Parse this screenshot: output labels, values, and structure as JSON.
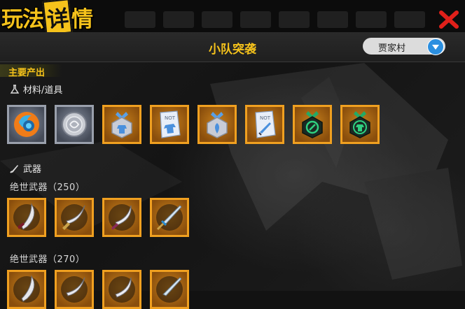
{
  "header": {
    "title_chars": [
      "玩",
      "法",
      "详",
      "情"
    ],
    "panel_title": "小队突袭",
    "dropdown": {
      "selected": "贾家村"
    }
  },
  "section": {
    "label": "主要产出",
    "materials": {
      "label": "材料/道具",
      "icon": "flask-icon",
      "items": [
        {
          "name": "orb-icon",
          "frame": "silver"
        },
        {
          "name": "silver-coin-icon",
          "frame": "silver"
        },
        {
          "name": "armor-badge-icon",
          "frame": "gold"
        },
        {
          "name": "armor-note-icon",
          "frame": "gold"
        },
        {
          "name": "shield-badge-icon",
          "frame": "gold"
        },
        {
          "name": "blade-note-icon",
          "frame": "gold"
        },
        {
          "name": "green-medal-icon",
          "frame": "gold"
        },
        {
          "name": "green-armor-medal-icon",
          "frame": "gold"
        }
      ]
    },
    "weapons": {
      "label": "武器",
      "icon": "blade-icon",
      "groups": [
        {
          "label": "绝世武器（250）",
          "items": [
            "claw-blade-icon",
            "scimitar-icon",
            "curved-sword-icon",
            "broadsword-icon"
          ]
        },
        {
          "label": "绝世武器（270）",
          "items": [
            "claw-blade-icon",
            "scimitar-icon",
            "curved-sword-icon",
            "broadsword-icon"
          ]
        }
      ]
    }
  },
  "colors": {
    "accent": "#f5c21b",
    "close": "#e0201a",
    "frame_gold": "#f0a020",
    "dropdown_arrow": "#2b8fe0"
  }
}
